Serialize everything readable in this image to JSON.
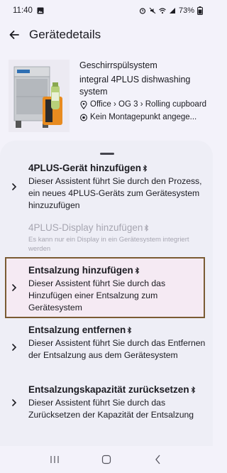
{
  "status_bar": {
    "time": "11:40",
    "battery": "73%"
  },
  "app_bar": {
    "title": "Gerätedetails"
  },
  "device": {
    "name": "Geschirrspülsystem",
    "model": "integral 4PLUS dishwashing system",
    "location": "Office › OG 3 › Rolling cupboard",
    "mount": "Kein Montagepunkt angege..."
  },
  "items": [
    {
      "title": "4PLUS-Gerät hinzufügen",
      "desc": "Dieser Assistent führt Sie durch den Prozess, ein neues 4PLUS-Geräts zum Gerätesystem hinzuzufügen",
      "enabled": true
    },
    {
      "title": "4PLUS-Display hinzufügen",
      "desc": "Es kann nur ein Display in ein Gerätesystem integriert werden",
      "enabled": false
    },
    {
      "title": "Entsalzung hinzufügen",
      "desc": "Dieser Assistent führt Sie durch das Hinzufügen einer Entsalzung zum Gerätesystem",
      "enabled": true,
      "highlighted": true
    },
    {
      "title": "Entsalzung entfernen",
      "desc": "Dieser Assistent führt Sie durch das Entfernen der Entsalzung aus dem Gerätesystem",
      "enabled": true
    },
    {
      "title": "Entsalzungskapazität zurücksetzen",
      "desc": "Dieser Assistent führt Sie durch das Zurücksetzen der Kapazität der Entsalzung",
      "enabled": true
    }
  ],
  "colors": {
    "highlight_border": "#7a5b33",
    "highlight_fill": "#f5eaf3",
    "disabled_text": "#a7a6b1"
  },
  "icons": {
    "back": "arrow-left-icon",
    "location": "map-pin-icon",
    "mount": "target-icon",
    "chevron": "chevron-right-icon",
    "bluetooth": "bluetooth-icon"
  }
}
